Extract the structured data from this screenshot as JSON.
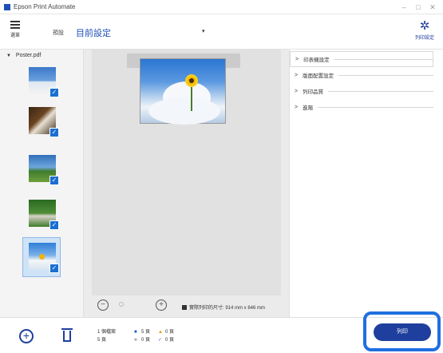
{
  "window": {
    "title": "Epson Print Automate",
    "controls": [
      "–",
      "□",
      "✕"
    ]
  },
  "header": {
    "menu_label": "選單",
    "preset_label": "預設",
    "preset_value": "目前設定",
    "preset_dropdown_icon": "▾",
    "print_settings_label": "列印設定"
  },
  "file_list": {
    "file_name": "Poster.pdf",
    "thumbnails": [
      {
        "icon": "landscape-sky-photo",
        "checked": true
      },
      {
        "icon": "dog-photo",
        "checked": true
      },
      {
        "icon": "puppy-sky-photo",
        "checked": true
      },
      {
        "icon": "dogs-grass-photo",
        "checked": true
      },
      {
        "icon": "flower-sky-photo",
        "checked": true
      }
    ],
    "check_glyph": "✓"
  },
  "preview": {
    "zoom_out_glyph": "−",
    "zoom_in_glyph": "+",
    "size_info": "實際列印的尺寸: 914 mm x 646 mm"
  },
  "settings_sections": [
    {
      "label": "印表機設定",
      "chevron": ">"
    },
    {
      "label": "版面配置設定",
      "chevron": ">"
    },
    {
      "label": "列印品質",
      "chevron": ">"
    },
    {
      "label": "進階",
      "chevron": ">"
    }
  ],
  "footer": {
    "add_glyph": "+",
    "summary_files": "1 個檔案",
    "summary_pages": "5 頁",
    "stats": {
      "selected": "5 頁",
      "warning": "0 頁",
      "skipped": "0 頁",
      "done": "0 頁"
    },
    "print_label": "列印"
  },
  "colors": {
    "accent": "#1e3f9e",
    "highlight": "#1f6fe0"
  }
}
